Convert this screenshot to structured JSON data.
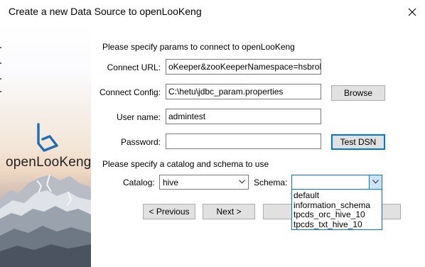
{
  "window": {
    "title": "Create a new Data Source to openLooKeng"
  },
  "brand": {
    "logo_text": "openLooKeng"
  },
  "intro": {
    "connect_text": "Please specify params to connect to openLooKeng",
    "catalog_text": "Please specify a catalog and schema to use"
  },
  "form": {
    "connect_url": {
      "label": "Connect URL:",
      "value": "oKeeper&zooKeeperNamespace=hsbroker"
    },
    "connect_config": {
      "label": "Connect Config:",
      "value": "C:\\hetu\\jdbc_param.properties"
    },
    "user_name": {
      "label": "User name:",
      "value": "admintest"
    },
    "password": {
      "label": "Password:",
      "value": ""
    }
  },
  "buttons": {
    "browse": "Browse",
    "test_dsn": "Test DSN",
    "previous": "< Previous",
    "next": "Next >"
  },
  "catalog": {
    "label": "Catalog:",
    "value": "hive"
  },
  "schema": {
    "label": "Schema:",
    "value": "",
    "options": [
      "default",
      "information_schema",
      "tpcds_orc_hive_10",
      "tpcds_txt_hive_10"
    ]
  },
  "colors": {
    "focus_blue": "#0078d7",
    "button_face": "#e1e1e1",
    "dropdown_highlight": "#cce4f7"
  },
  "icons": {
    "close": "close-icon",
    "dropdown": "chevron-down-icon",
    "logo": "openlookeng-logo-icon"
  }
}
